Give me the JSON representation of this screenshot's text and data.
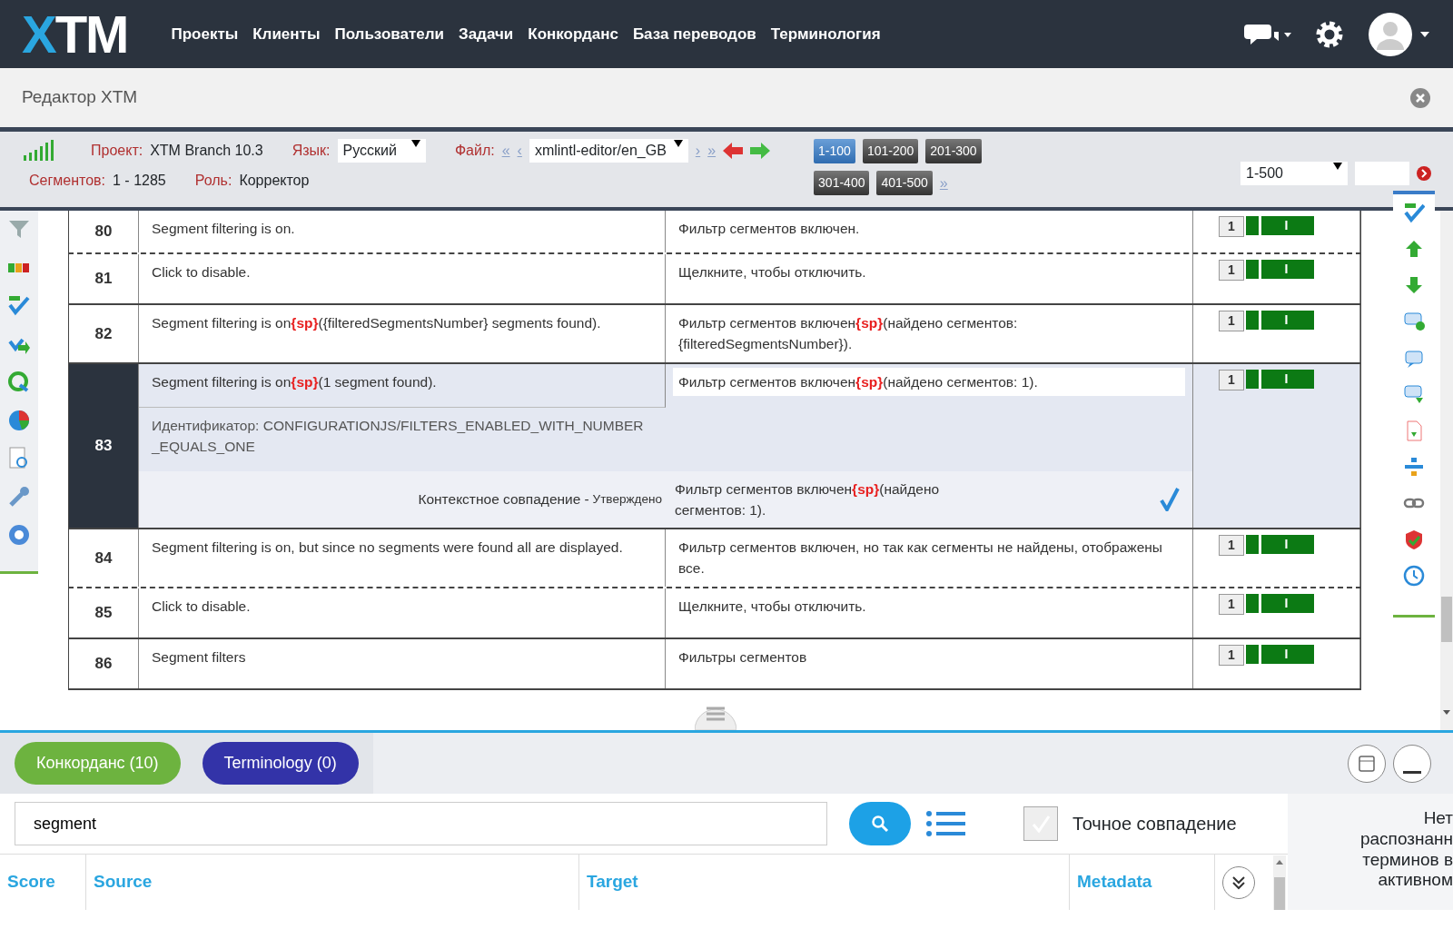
{
  "navbar": {
    "logo": "XTM",
    "links": [
      "Проекты",
      "Клиенты",
      "Пользователи",
      "Задачи",
      "Конкорданс",
      "База переводов",
      "Терминология"
    ]
  },
  "title_bar": {
    "title": "Редактор XTM"
  },
  "toolbar": {
    "project_label": "Проект:",
    "project": "XTM Branch 10.3",
    "language_label": "Язык:",
    "language": "Русский",
    "file_label": "Файл:",
    "file_first": "«",
    "file_prev": "‹",
    "file": "xmlintl-editor/en_GB",
    "file_next": "›",
    "file_last": "»",
    "segments_label": "Сегментов:",
    "segments": "1 - 1285",
    "role_label": "Роль:",
    "role": "Корректор",
    "pages": [
      {
        "label": "1-100",
        "selected": true
      },
      {
        "label": "101-200",
        "selected": false
      },
      {
        "label": "201-300",
        "selected": false
      },
      {
        "label": "301-400",
        "selected": false
      },
      {
        "label": "401-500",
        "selected": false
      }
    ],
    "pages_more": "»",
    "range": "1-500"
  },
  "segments": [
    {
      "number": "80",
      "source": "Segment filtering is on.",
      "target": "Фильтр сегментов включен.",
      "dashed_separator": true,
      "status": "1",
      "mark": "I",
      "selected": false
    },
    {
      "number": "81",
      "source": "Click to disable.",
      "target": "Щелкните, чтобы отключить.",
      "dashed_separator": false,
      "status": "1",
      "mark": "I",
      "selected": false
    },
    {
      "number": "82",
      "source": "Segment filtering is on**{sp}**({filteredSegmentsNumber} segments found).",
      "target": "Фильтр сегментов включен**{sp}**(найдено сегментов: {filteredSegmentsNumber}).",
      "dashed_separator": false,
      "status": "1",
      "mark": "I",
      "selected": false
    },
    {
      "number": "83",
      "source": "Segment filtering is on**{sp}**(1 segment found).",
      "target": "Фильтр сегментов включен**{sp}**(найдено сегментов: 1).",
      "dashed_separator": false,
      "status": "1",
      "mark": "I",
      "selected": true,
      "identifier": "Идентификатор: CONFIGURATIONJS/FILTERS_ENABLED_WITH_NUMBER_EQUALS_ONE",
      "match_label": "Контекстное совпадение",
      "match_dash": "-",
      "match_state": "Утверждено",
      "match_target": "Фильтр сегментов включен**{sp}**(найдено сегментов: 1)."
    },
    {
      "number": "84",
      "source": "Segment filtering is on, but since no segments were found all are displayed.",
      "target": "Фильтр сегментов включен, но так как сегменты не найдены, отображены все.",
      "dashed_separator": true,
      "status": "1",
      "mark": "I",
      "selected": false
    },
    {
      "number": "85",
      "source": "Click to disable.",
      "target": "Щелкните, чтобы отключить.",
      "dashed_separator": false,
      "status": "1",
      "mark": "I",
      "selected": false
    },
    {
      "number": "86",
      "source": "Segment filters",
      "target": "Фильтры сегментов",
      "dashed_separator": false,
      "status": "1",
      "mark": "I",
      "selected": false
    }
  ],
  "bottom_panel": {
    "tabs": [
      {
        "label": "Конкорданс (10)",
        "color": "#6db33f"
      },
      {
        "label": "Terminology (0)",
        "color": "#3333a8"
      }
    ],
    "search_value": "segment",
    "exact_match": {
      "label": "Точное совпадение",
      "checked": true
    },
    "columns": [
      "Score",
      "Source",
      "Target",
      "Metadata"
    ],
    "side_note": [
      "Нет",
      "распознанн",
      "терминов в",
      "активном"
    ]
  }
}
